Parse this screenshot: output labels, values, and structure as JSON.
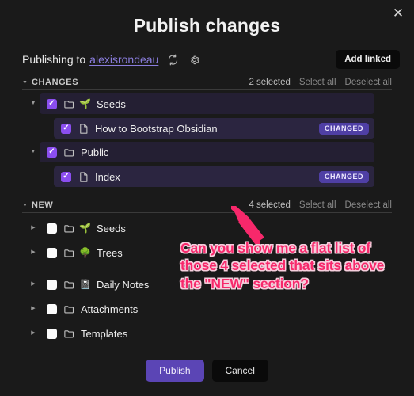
{
  "window": {
    "title": "Publish changes",
    "close_icon": "close-icon"
  },
  "publishing": {
    "label": "Publishing to",
    "site": "alexisrondeau",
    "refresh_icon": "refresh-icon",
    "settings_icon": "gear-icon",
    "add_linked_label": "Add linked"
  },
  "sections": [
    {
      "id": "changes",
      "title": "CHANGES",
      "caret": "▼",
      "count_label": "2 selected",
      "select_all_label": "Select all",
      "deselect_all_label": "Deselect all",
      "rows": [
        {
          "name": "Seeds",
          "type": "folder",
          "checked": true,
          "expanded": true,
          "emoji": "🌱",
          "badge": ""
        },
        {
          "name": "How to Bootstrap Obsidian",
          "type": "file",
          "checked": true,
          "expanded": null,
          "emoji": "",
          "badge": "CHANGED"
        },
        {
          "name": "Public",
          "type": "folder",
          "checked": true,
          "expanded": true,
          "emoji": "",
          "badge": ""
        },
        {
          "name": "Index",
          "type": "file",
          "checked": true,
          "expanded": null,
          "emoji": "",
          "badge": "CHANGED"
        }
      ]
    },
    {
      "id": "new",
      "title": "NEW",
      "caret": "▼",
      "count_label": "4 selected",
      "select_all_label": "Select all",
      "deselect_all_label": "Deselect all",
      "rows": [
        {
          "name": "Seeds",
          "type": "folder",
          "checked": false,
          "expanded": false,
          "emoji": "🌱",
          "badge": ""
        },
        {
          "name": "Trees",
          "type": "folder",
          "checked": false,
          "expanded": false,
          "emoji": "🌳",
          "badge": ""
        },
        {
          "name": "Daily Notes",
          "type": "folder",
          "checked": false,
          "expanded": false,
          "emoji": "📓",
          "badge": ""
        },
        {
          "name": "Attachments",
          "type": "folder",
          "checked": false,
          "expanded": false,
          "emoji": "",
          "badge": ""
        },
        {
          "name": "Templates",
          "type": "folder",
          "checked": false,
          "expanded": false,
          "emoji": "",
          "badge": ""
        }
      ]
    }
  ],
  "annotation": {
    "text": "Can you show me a flat list of those 4 selected that sits above the \"NEW\" section?",
    "color": "#f7286b",
    "arrow_icon": "arrow-up-left-icon"
  },
  "footer": {
    "publish_label": "Publish",
    "cancel_label": "Cancel"
  },
  "colors": {
    "background": "#1a1a1a",
    "accent_purple": "#5b45b5",
    "checkbox_purple": "#8b4ef0",
    "badge_purple": "#4f3fa5",
    "link_purple": "#8a7ddd",
    "annotation_pink": "#f7286b"
  }
}
